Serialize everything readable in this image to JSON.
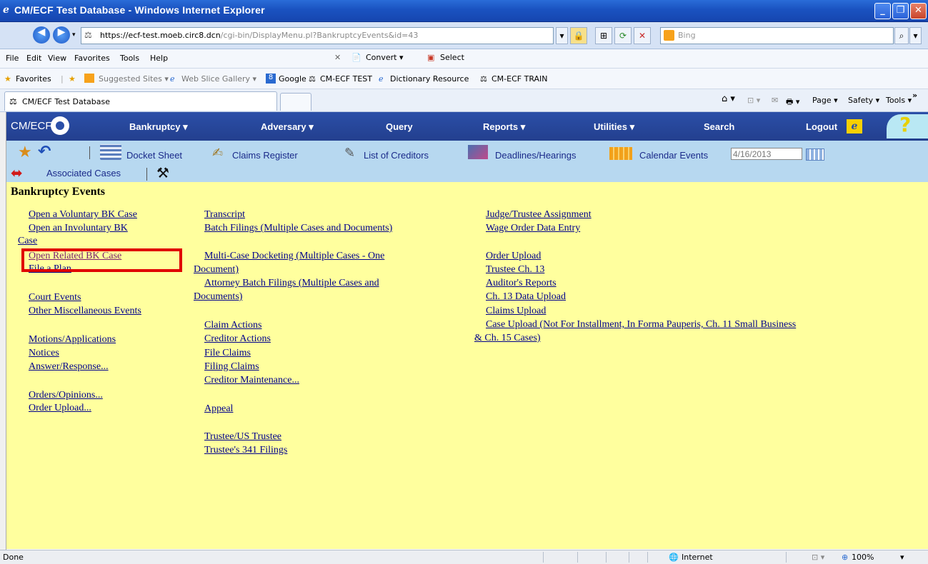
{
  "window": {
    "title": "CM/ECF Test Database - Windows Internet Explorer",
    "minimize": "_",
    "restore": "❐",
    "close": "✕"
  },
  "address": {
    "url_prefix": "https://",
    "url_domain": "ecf-test.moeb.circ8.dcn",
    "url_path": "/cgi-bin/DisplayMenu.pl?BankruptcyEvents&id=43"
  },
  "search": {
    "placeholder": "Bing"
  },
  "menu": {
    "file": "File",
    "edit": "Edit",
    "view": "View",
    "favorites": "Favorites",
    "tools": "Tools",
    "help": "Help",
    "convert": "Convert ▾",
    "select": "Select"
  },
  "favorites_bar": {
    "favorites": "Favorites",
    "items": [
      "Suggested Sites ▾",
      "Web Slice Gallery ▾",
      "Google",
      "CM-ECF TEST",
      "Dictionary Resource",
      "CM-ECF TRAIN"
    ]
  },
  "tab": {
    "label": "CM/ECF Test Database"
  },
  "commandbar": {
    "page": "Page ▾",
    "safety": "Safety ▾",
    "tools": "Tools ▾",
    "help": "? ▾",
    "more": "»"
  },
  "cmecf_nav": {
    "logo": "CM/ECF",
    "items": [
      "Bankruptcy ▾",
      "Adversary ▾",
      "Query",
      "Reports ▾",
      "Utilities ▾",
      "Search",
      "Logout"
    ]
  },
  "toolbar": {
    "docket_sheet": "Docket Sheet",
    "claims_register": "Claims Register",
    "list_of_creditors": "List of Creditors",
    "deadlines_hearings": "Deadlines/Hearings",
    "calendar_events": "Calendar Events",
    "date": "4/16/2013",
    "associated_cases": "Associated Cases"
  },
  "heading": "Bankruptcy Events",
  "col1": {
    "open_voluntary": "Open a Voluntary BK Case",
    "open_involuntary_1": "Open an Involuntary BK",
    "open_involuntary_2": "Case",
    "open_related": "Open Related BK Case",
    "file_plan": "File a Plan",
    "court_events": "Court Events",
    "other_misc": "Other Miscellaneous Events",
    "motions": "Motions/Applications",
    "notices": "Notices",
    "answer": "Answer/Response...",
    "orders": "Orders/Opinions...",
    "order_upload": "Order Upload..."
  },
  "col2": {
    "transcript": "Transcript",
    "batch_filings": "Batch Filings (Multiple Cases and Documents)",
    "multi_case_1": "Multi-Case Docketing (Multiple Cases - One",
    "multi_case_2": "Document)",
    "attorney_batch_1": "Attorney Batch Filings (Multiple Cases and",
    "attorney_batch_2": "Documents)",
    "claim_actions": "Claim Actions",
    "creditor_actions": "Creditor Actions",
    "file_claims": "File Claims",
    "filing_claims": "Filing Claims",
    "creditor_maint": "Creditor Maintenance...",
    "appeal": "Appeal",
    "trustee_us": "Trustee/US Trustee",
    "trustee_341": "Trustee's 341 Filings"
  },
  "col3": {
    "judge_trustee": "Judge/Trustee Assignment",
    "wage_order": "Wage Order Data Entry",
    "order_upload": "Order Upload",
    "trustee_ch13": "Trustee Ch. 13",
    "auditors": "Auditor's Reports",
    "ch13_data": "Ch. 13 Data Upload",
    "claims_upload": "Claims Upload",
    "case_upload_1": "Case Upload (Not For Installment, In Forma Pauperis, Ch. 11 Small Business",
    "case_upload_2": "& Ch. 15 Cases)"
  },
  "status": {
    "left": "Done",
    "zone": "Internet",
    "zoom": "100%"
  },
  "colors": {
    "page_bg": "#ffff9e",
    "nav_bg": "#2b4fa8",
    "toolbar_bg": "#b7d8f0",
    "highlight": "#e00000",
    "link": "#00008b"
  }
}
